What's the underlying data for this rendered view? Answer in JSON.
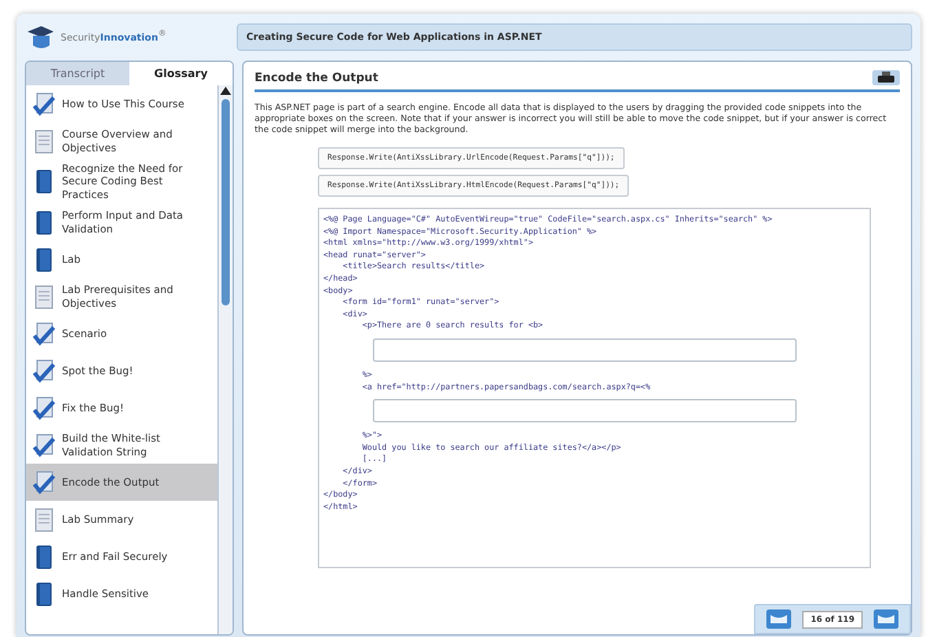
{
  "logo": {
    "text": "Security**Innovation**$^{®}$"
  },
  "course_title": "Creating Secure Code for Web Applications in ASP.NET",
  "tabs": [
    {
      "label": "Transcript",
      "selected": false
    },
    {
      "label": "Glossary",
      "selected": true
    }
  ],
  "sidebar": {
    "items": [
      {
        "label": "How to Use This Course",
        "kind": "check",
        "selected": false
      },
      {
        "label": "Course Overview and Objectives",
        "kind": "page",
        "selected": false
      },
      {
        "label": "Recognize the Need for Secure Coding Best Practices",
        "kind": "book",
        "selected": false
      },
      {
        "label": "Perform Input and Data Validation",
        "kind": "book",
        "selected": false
      },
      {
        "label": "Lab",
        "kind": "book",
        "selected": false
      },
      {
        "label": "Lab Prerequisites and Objectives",
        "kind": "page",
        "selected": false
      },
      {
        "label": "Scenario",
        "kind": "check",
        "selected": false
      },
      {
        "label": "Spot the Bug!",
        "kind": "check",
        "selected": false
      },
      {
        "label": "Fix the Bug!",
        "kind": "check",
        "selected": false
      },
      {
        "label": "Build the White-list Validation String",
        "kind": "check",
        "selected": false
      },
      {
        "label": "Encode the Output",
        "kind": "check",
        "selected": true
      },
      {
        "label": "Lab Summary",
        "kind": "page",
        "selected": false
      },
      {
        "label": "Err and Fail Securely",
        "kind": "book",
        "selected": false
      },
      {
        "label": "Handle Sensitive",
        "kind": "book",
        "selected": false
      }
    ]
  },
  "page": {
    "title": "Encode the Output",
    "instructions": "This ASP.NET page is part of a search engine. Encode all data that is displayed to the users by dragging the provided code snippets into the appropriate boxes on the screen. Note that if your answer is incorrect you will still be able to move the code snippet, but if your answer is correct the code snippet will merge into the background.",
    "snippets": [
      "Response.Write(AntiXssLibrary.UrlEncode(Request.Params[\"q\"]));",
      "Response.Write(AntiXssLibrary.HtmlEncode(Request.Params[\"q\"]));"
    ],
    "code": [
      {
        "kind": "line",
        "text": "<%@ Page Language=\"C#\" AutoEventWireup=\"true\" CodeFile=\"search.aspx.cs\" Inherits=\"search\" %>"
      },
      {
        "kind": "line",
        "text": "<%@ Import Namespace=\"Microsoft.Security.Application\" %>"
      },
      {
        "kind": "line",
        "text": "<html xmlns=\"http://www.w3.org/1999/xhtml\">"
      },
      {
        "kind": "line",
        "text": "<head runat=\"server\">"
      },
      {
        "kind": "line",
        "text": "    <title>Search results</title>"
      },
      {
        "kind": "line",
        "text": "</head>"
      },
      {
        "kind": "line",
        "text": "<body>"
      },
      {
        "kind": "line",
        "text": "    <form id=\"form1\" runat=\"server\">"
      },
      {
        "kind": "line",
        "text": "    <div>"
      },
      {
        "kind": "line",
        "text": "        <p>There are 0 search results for <b>"
      },
      {
        "kind": "dropzone"
      },
      {
        "kind": "line",
        "text": "        %>"
      },
      {
        "kind": "line",
        "text": "        <a href=\"http://partners.papersandbags.com/search.aspx?q=<%"
      },
      {
        "kind": "dropzone"
      },
      {
        "kind": "line",
        "text": "        %>\">"
      },
      {
        "kind": "line",
        "text": "        Would you like to search our affiliate sites?</a></p>"
      },
      {
        "kind": "line",
        "text": "        [...]"
      },
      {
        "kind": "line",
        "text": "    </div>"
      },
      {
        "kind": "line",
        "text": "    </form>"
      },
      {
        "kind": "line",
        "text": "</body>"
      },
      {
        "kind": "line",
        "text": "</html>"
      }
    ]
  },
  "pager": {
    "text": "16 of 119"
  }
}
